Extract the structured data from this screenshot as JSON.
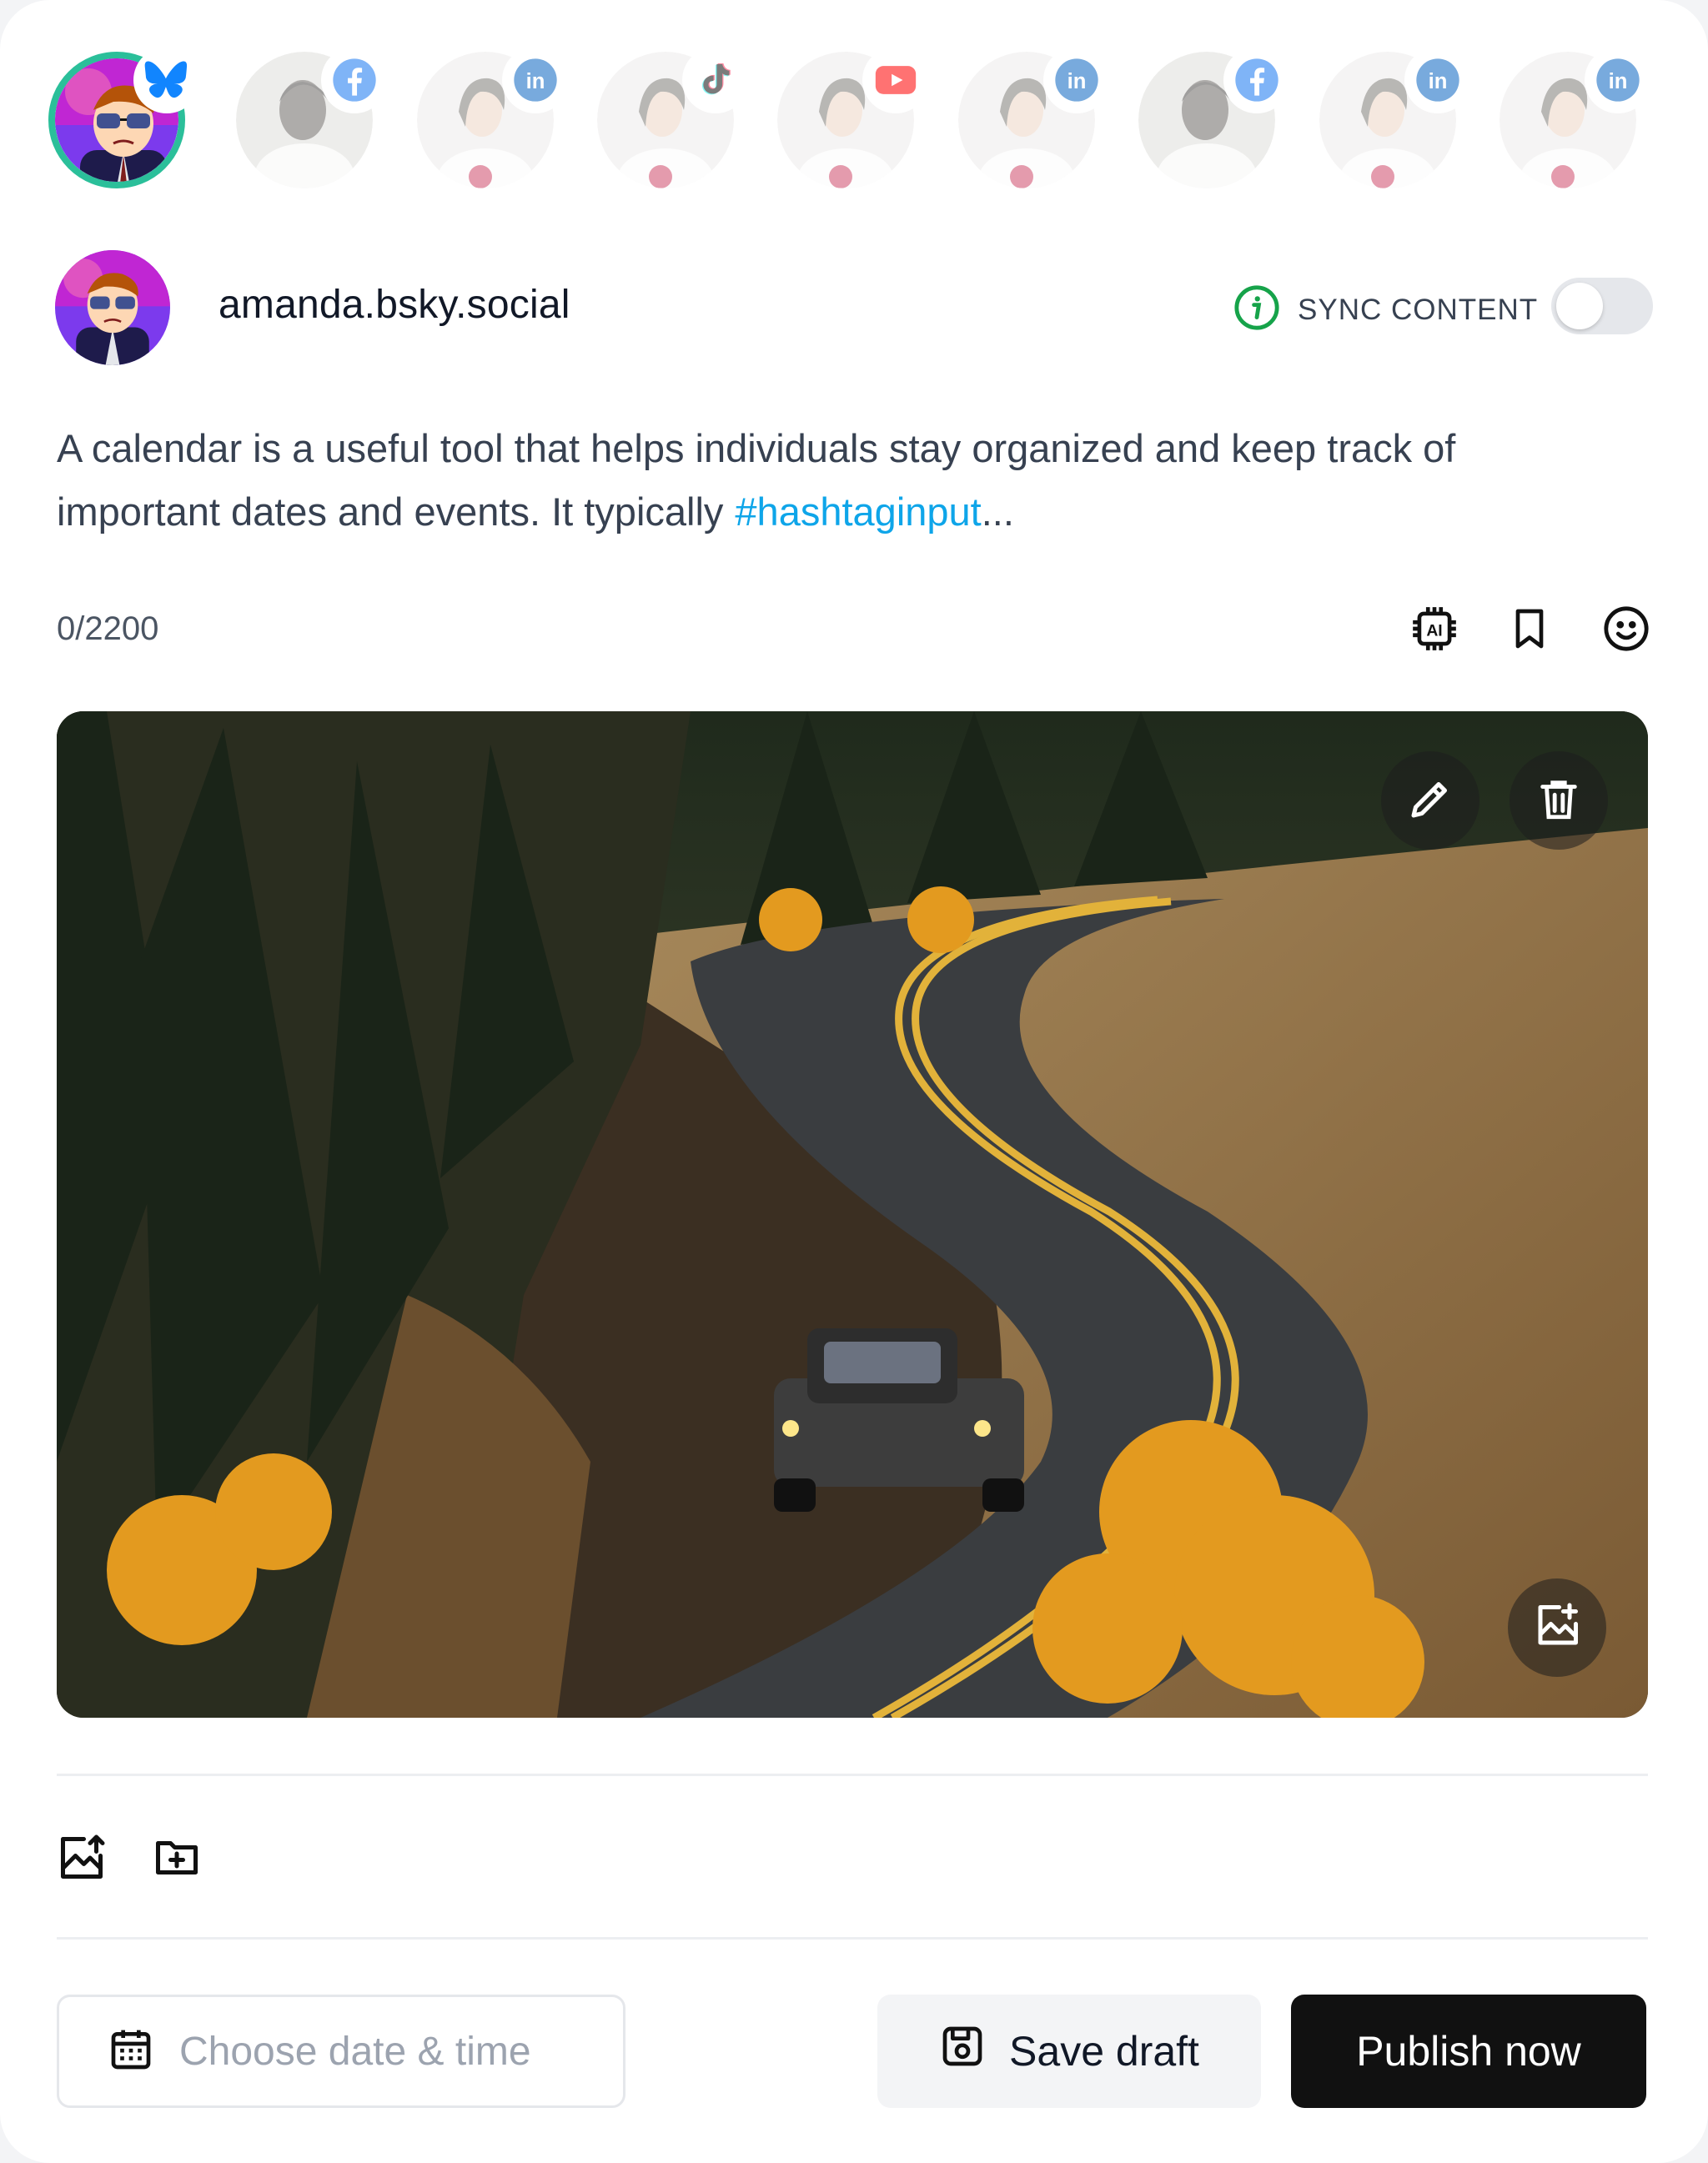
{
  "accounts": [
    {
      "name": "bluesky-account",
      "network": "bluesky",
      "active": true
    },
    {
      "name": "facebook-account",
      "network": "facebook",
      "active": false
    },
    {
      "name": "linkedin-account",
      "network": "linkedin",
      "active": false
    },
    {
      "name": "tiktok-account",
      "network": "tiktok",
      "active": false
    },
    {
      "name": "youtube-account",
      "network": "youtube",
      "active": false
    },
    {
      "name": "linkedin-account",
      "network": "linkedin",
      "active": false
    },
    {
      "name": "facebook-account",
      "network": "facebook",
      "active": false
    },
    {
      "name": "linkedin-account",
      "network": "linkedin",
      "active": false
    },
    {
      "name": "linkedin-account",
      "network": "linkedin",
      "active": false
    }
  ],
  "profile": {
    "username": "amanda.bsky.social"
  },
  "sync": {
    "label": "SYNC CONTENT",
    "enabled": false
  },
  "post": {
    "text": "A calendar is a useful tool that helps individuals stay organized and keep track of important dates and events. It typically",
    "hashtag": "#hashtaginput",
    "ellipsis": "..."
  },
  "counter": "0/2200",
  "toolbar": {
    "icons": [
      "ai-chip-icon",
      "bookmark-icon",
      "emoji-icon"
    ]
  },
  "media": {
    "overlay_icons": [
      "pencil-icon",
      "trash-icon",
      "add-image-icon"
    ]
  },
  "attach": {
    "icons": [
      "upload-image-icon",
      "add-folder-icon"
    ]
  },
  "footer": {
    "date_placeholder": "Choose date & time",
    "save_draft_label": "Save draft",
    "publish_label": "Publish now"
  },
  "colors": {
    "accent_ring": "#2bbf9a",
    "hashtag": "#0ea5e9",
    "publish_bg": "#111111",
    "sync_icon": "#16a34a"
  }
}
